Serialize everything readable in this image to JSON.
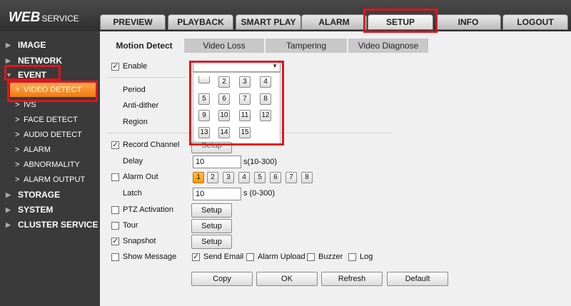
{
  "app": {
    "logo_main": "WEB",
    "logo_sub": "SERVICE"
  },
  "top_tabs": [
    "PREVIEW",
    "PLAYBACK",
    "SMART PLAY",
    "ALARM",
    "SETUP",
    "INFO",
    "LOGOUT"
  ],
  "sidebar": {
    "image": "IMAGE",
    "network": "NETWORK",
    "event": "EVENT",
    "video_detect": "VIDEO DETECT",
    "ivs": "IVS",
    "face_detect": "FACE DETECT",
    "audio_detect": "AUDIO DETECT",
    "alarm": "ALARM",
    "abnormality": "ABNORMALITY",
    "alarm_output": "ALARM OUTPUT",
    "storage": "STORAGE",
    "system": "SYSTEM",
    "cluster_service": "CLUSTER SERVICE"
  },
  "sub_tabs": [
    "Motion Detect",
    "Video Loss",
    "Tampering",
    "Video Diagnose"
  ],
  "form": {
    "enable": "Enable",
    "period": "Period",
    "anti_dither": "Anti-dither",
    "region": "Region",
    "record_channel": "Record Channel",
    "delay": "Delay",
    "delay_value": "10",
    "delay_hint": "s(10-300)",
    "alarm_out": "Alarm Out",
    "latch": "Latch",
    "latch_value": "10",
    "latch_hint": "s (0-300)",
    "ptz_activation": "PTZ Activation",
    "tour": "Tour",
    "snapshot": "Snapshot",
    "show_message": "Show Message",
    "send_email": "Send Email",
    "alarm_upload": "Alarm Upload",
    "buzzer": "Buzzer",
    "log": "Log",
    "setup_label": "Setup",
    "setup_partial": "Setup",
    "check_mark": "✓"
  },
  "channel_grid": [
    "",
    "2",
    "3",
    "4",
    "5",
    "6",
    "7",
    "8",
    "9",
    "10",
    "11",
    "12",
    "13",
    "14",
    "15"
  ],
  "alarm_outputs": [
    "1",
    "2",
    "3",
    "4",
    "5",
    "6",
    "7",
    "8"
  ],
  "actions": {
    "copy": "Copy",
    "ok": "OK",
    "refresh": "Refresh",
    "default": "Default"
  },
  "colors": {
    "highlight": "#e0141e",
    "selected_nav": "#f5891e"
  }
}
